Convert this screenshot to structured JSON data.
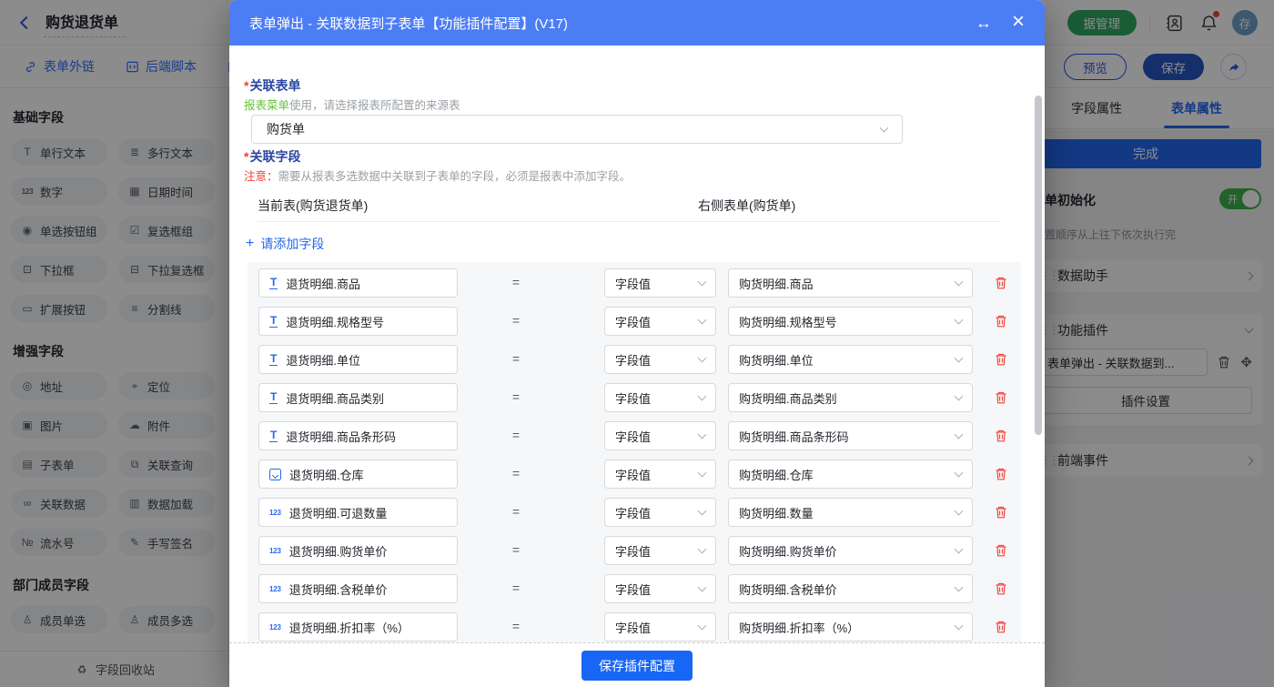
{
  "app": {
    "header": {
      "title": "购货退货单",
      "data_manage_label": "据管理",
      "avatar_text": "存"
    },
    "toolbar": {
      "links": [
        {
          "label": "表单外链"
        },
        {
          "label": "后端脚本"
        }
      ],
      "preview_label": "预览",
      "save_label": "保存"
    },
    "sidebar": {
      "sections": [
        {
          "title": "基础字段",
          "items": [
            {
              "glyph": "T",
              "label": "单行文本",
              "icon": "single-line-text-icon"
            },
            {
              "glyph": "≣",
              "label": "多行文本",
              "icon": "multi-line-text-icon"
            },
            {
              "glyph": "123",
              "label": "数字",
              "icon": "number-icon"
            },
            {
              "glyph": "▦",
              "label": "日期时间",
              "icon": "datetime-icon"
            },
            {
              "glyph": "◉",
              "label": "单选按钮组",
              "icon": "radio-group-icon"
            },
            {
              "glyph": "☑",
              "label": "复选框组",
              "icon": "checkbox-group-icon"
            },
            {
              "glyph": "⊡",
              "label": "下拉框",
              "icon": "dropdown-icon"
            },
            {
              "glyph": "⊟",
              "label": "下拉复选框",
              "icon": "dropdown-multi-icon"
            },
            {
              "glyph": "▭",
              "label": "扩展按钮",
              "icon": "extend-button-icon"
            },
            {
              "glyph": "≡",
              "label": "分割线",
              "icon": "divider-icon"
            }
          ]
        },
        {
          "title": "增强字段",
          "items": [
            {
              "glyph": "◎",
              "label": "地址",
              "icon": "address-icon"
            },
            {
              "glyph": "⌖",
              "label": "定位",
              "icon": "location-icon"
            },
            {
              "glyph": "▣",
              "label": "图片",
              "icon": "image-icon"
            },
            {
              "glyph": "☁",
              "label": "附件",
              "icon": "attachment-icon"
            },
            {
              "glyph": "▤",
              "label": "子表单",
              "icon": "subform-icon"
            },
            {
              "glyph": "⧉",
              "label": "关联查询",
              "icon": "linked-query-icon"
            },
            {
              "glyph": "∞",
              "label": "关联数据",
              "icon": "linked-data-icon"
            },
            {
              "glyph": "▥",
              "label": "数据加载",
              "icon": "data-load-icon"
            },
            {
              "glyph": "№",
              "label": "流水号",
              "icon": "serial-number-icon"
            },
            {
              "glyph": "✎",
              "label": "手写签名",
              "icon": "signature-icon"
            }
          ]
        },
        {
          "title": "部门成员字段",
          "items": [
            {
              "glyph": "♙",
              "label": "成员单选",
              "icon": "member-single-icon"
            },
            {
              "glyph": "♙",
              "label": "成员多选",
              "icon": "member-multi-icon"
            }
          ]
        }
      ],
      "recycle": {
        "glyph": "♻",
        "label": "字段回收站"
      }
    },
    "right_panel": {
      "tab_field": "字段属性",
      "tab_form": "表单属性",
      "active_tab": "表单属性",
      "done_label": "完成",
      "init_label": "单初始化",
      "toggle_label": "开",
      "init_desc": "置顺序从上往下依次执行完",
      "data_helper": "数据助手",
      "plugin_title": "功能插件",
      "plugin_value": "表单弹出 - 关联数据到...",
      "plugin_settings": "插件设置",
      "frontend_events": "前端事件"
    }
  },
  "modal": {
    "title": "表单弹出 - 关联数据到子表单【功能插件配置】(V17)",
    "expand_glyph": "↔",
    "close_glyph": "×",
    "form_label": "关联表单",
    "required_mark": "*",
    "form_help_green": "报表菜单",
    "form_help_rest": "使用，请选择报表所配置的来源表",
    "form_value": "购货单",
    "fields_label": "关联字段",
    "note_prefix": "注意：",
    "note_text": "需要从报表多选数据中关联到子表单的字段，必须是报表中添加字段。",
    "col_left": "当前表(购货退货单)",
    "col_right": "右侧表单(购货单)",
    "add_plus": "+",
    "add_field_label": "请添加字段",
    "equals": "=",
    "rows": [
      {
        "type": "text",
        "left": "退货明细.商品",
        "op": "字段值",
        "right": "购货明细.商品"
      },
      {
        "type": "text",
        "left": "退货明细.规格型号",
        "op": "字段值",
        "right": "购货明细.规格型号"
      },
      {
        "type": "text",
        "left": "退货明细.单位",
        "op": "字段值",
        "right": "购货明细.单位"
      },
      {
        "type": "text",
        "left": "退货明细.商品类别",
        "op": "字段值",
        "right": "购货明细.商品类别"
      },
      {
        "type": "text",
        "left": "退货明细.商品条形码",
        "op": "字段值",
        "right": "购货明细.商品条形码"
      },
      {
        "type": "select",
        "left": "退货明细.仓库",
        "op": "字段值",
        "right": "购货明细.仓库"
      },
      {
        "type": "number",
        "left": "退货明细.可退数量",
        "op": "字段值",
        "right": "购货明细.数量"
      },
      {
        "type": "number",
        "left": "退货明细.购货单价",
        "op": "字段值",
        "right": "购货明细.购货单价"
      },
      {
        "type": "number",
        "left": "退货明细.含税单价",
        "op": "字段值",
        "right": "购货明细.含税单价"
      },
      {
        "type": "number",
        "left": "退货明细.折扣率（%）",
        "op": "字段值",
        "right": "购货明细.折扣率（%）"
      }
    ],
    "save_button": "保存插件配置"
  },
  "colors": {
    "modal_header_blue": "#4b7df5",
    "accent_blue": "#2468f2",
    "save_blue": "#1766f6",
    "green_pill": "#2ea861",
    "toggle_green": "#3db14e",
    "help_green": "#67c23a",
    "alert_red": "#f04134",
    "trash_red": "#f0483e"
  }
}
